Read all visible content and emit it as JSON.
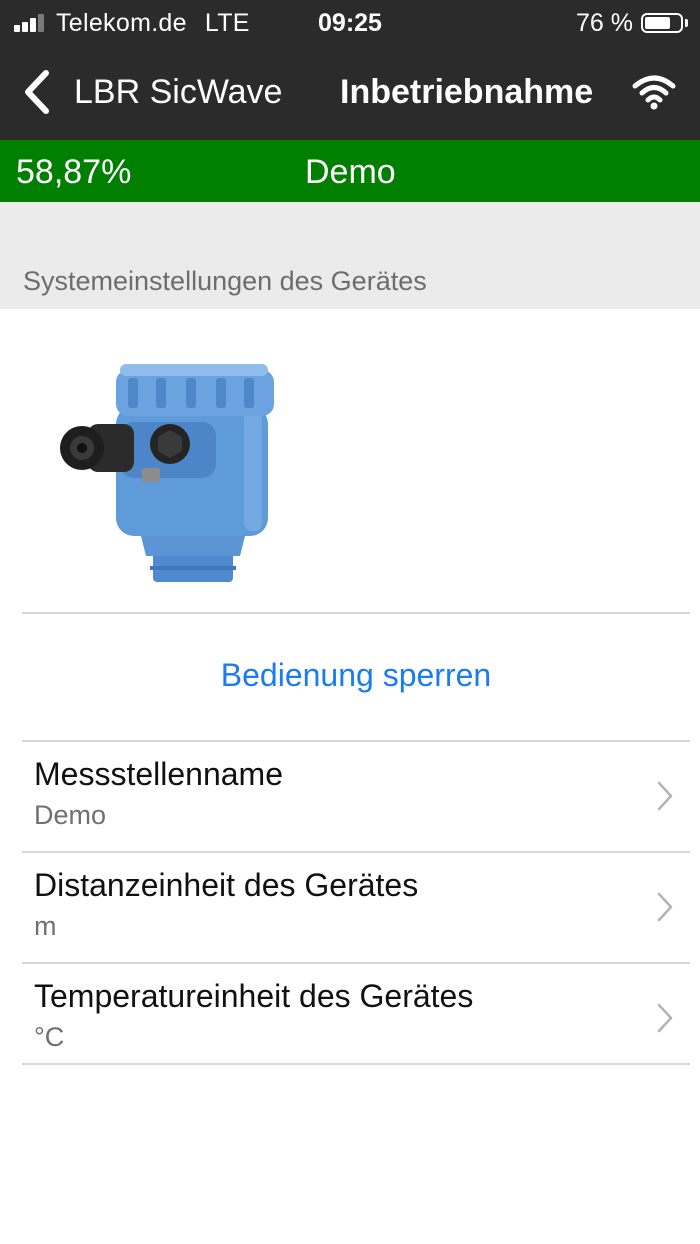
{
  "status_bar": {
    "carrier": "Telekom.de",
    "network": "LTE",
    "time": "09:25",
    "battery_text": "76 %",
    "battery_level": 0.76,
    "signal_bars_filled": 3
  },
  "nav": {
    "back_label": "LBR SicWave",
    "title": "Inbetriebnahme",
    "back_icon": "chevron-left-icon",
    "wifi_icon": "wifi-icon"
  },
  "progress": {
    "percent_text": "58,87%",
    "label": "Demo",
    "color": "#007f00"
  },
  "section": {
    "header": "Systemeinstellungen des Gerätes"
  },
  "device": {
    "image_icon": "radar-level-sensor-image",
    "body_color": "#5b95d6"
  },
  "actions": {
    "lock_label": "Bedienung sperren",
    "link_color": "#1a7cf0"
  },
  "settings": [
    {
      "label": "Messstellenname",
      "value": "Demo"
    },
    {
      "label": "Distanzeinheit des Gerätes",
      "value": "m"
    },
    {
      "label": "Temperatureinheit des Gerätes",
      "value": "°C"
    }
  ]
}
